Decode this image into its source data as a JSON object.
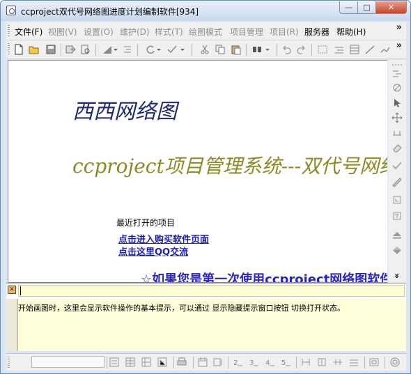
{
  "window": {
    "title": "ccproject双代号网络图进度计划编制软件[934]",
    "minimize_glyph": "—",
    "maximize_glyph": "□",
    "close_glyph": "✕"
  },
  "menu": {
    "items": [
      {
        "label": "文件(F)",
        "enabled": true
      },
      {
        "label": "视图(V)",
        "enabled": false
      },
      {
        "label": "设置(O)",
        "enabled": false
      },
      {
        "label": "维护(D)",
        "enabled": false
      },
      {
        "label": "样式(T)",
        "enabled": false
      },
      {
        "label": "绘图模式",
        "enabled": false
      },
      {
        "label": "项目管理",
        "enabled": false
      },
      {
        "label": "项目(R)",
        "enabled": false
      },
      {
        "label": "服务器",
        "enabled": true
      },
      {
        "label": "帮助(H)",
        "enabled": true
      }
    ],
    "overflow": "»"
  },
  "toolbar": {
    "overflow": "»",
    "icons": [
      "new-file-icon",
      "open-folder-icon",
      "save-icon",
      "export-icon",
      "print-preview-icon",
      "triangle-icon",
      "dropdown-icon",
      "indent-icon",
      "refresh-icon",
      "dropdown-icon",
      "check-tool-icon",
      "dropdown-icon",
      "cut-icon",
      "copy-icon",
      "paste-icon",
      "find-icon",
      "dropdown-icon",
      "undo-icon",
      "redo-icon",
      "link-icon",
      "align-icon",
      "table-icon",
      "line-tool-icon"
    ]
  },
  "content": {
    "title": "西西网络图",
    "subtitle": "ccproject项目管理系统---双代号网络图",
    "recent_label": "最近打开的项目",
    "links": [
      "点击进入购买软件页面",
      "点击这里QQ交流"
    ],
    "welcome": "☆如果您是第一次使用ccproject网络图软件"
  },
  "side_toolbar": {
    "icons": [
      "grid-icon",
      "node-tool-icon",
      "pointer-icon",
      "move-icon",
      "connector-icon",
      "eraser-icon",
      "check-icon",
      "ruler-icon",
      "resize-icon",
      "text-tool-icon",
      "up-arrow-icon",
      "down-arrow-icon"
    ],
    "scroll_glyph": "»"
  },
  "hint": {
    "close_glyph": "✕",
    "input_value": "",
    "text": "开始画图时，这里会显示软件操作的基本提示，可以通过 显示隐藏提示窗口按钮 切换打开状态。"
  },
  "status": {
    "field_value": ""
  }
}
